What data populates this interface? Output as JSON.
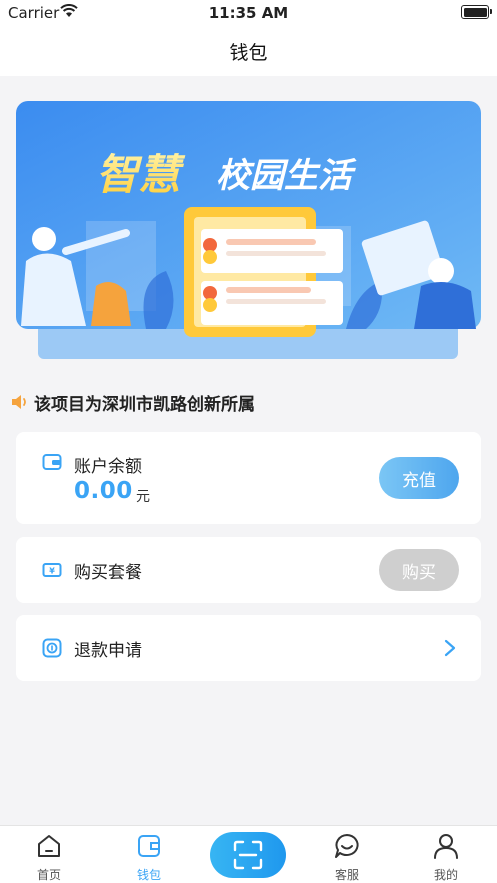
{
  "status_bar": {
    "carrier": "Carrier",
    "time": "11:35 AM"
  },
  "nav": {
    "title": "钱包"
  },
  "banner": {
    "headline_part1": "智慧",
    "headline_part2": "校园生活"
  },
  "notice": {
    "text": "该项目为深圳市凯路创新所属"
  },
  "balance": {
    "label": "账户余额",
    "amount": "0.00",
    "unit": "元",
    "recharge_label": "充值"
  },
  "package": {
    "label": "购买套餐",
    "buy_label": "购买"
  },
  "refund": {
    "label": "退款申请"
  },
  "tabs": [
    {
      "label": "首页",
      "icon": "home-icon"
    },
    {
      "label": "钱包",
      "icon": "wallet-icon",
      "active": true
    },
    {
      "label": "",
      "icon": "scan-icon"
    },
    {
      "label": "客服",
      "icon": "chat-icon"
    },
    {
      "label": "我的",
      "icon": "user-icon"
    }
  ],
  "colors": {
    "accent": "#3aa4f5",
    "banner_bg": "#4a9cf0",
    "disabled": "#cfcfcf"
  }
}
